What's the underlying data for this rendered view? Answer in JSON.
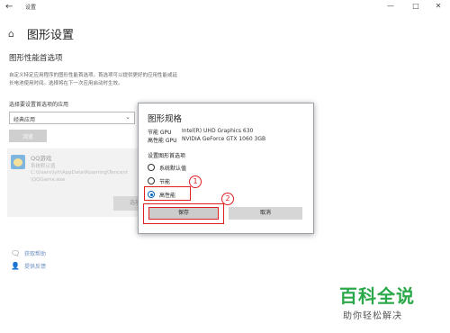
{
  "window": {
    "title": "设置",
    "back_icon": "←",
    "minimize_icon": "—",
    "maximize_icon": "□",
    "close_icon": "✕"
  },
  "page": {
    "home_icon": "⌂",
    "title": "图形设置",
    "section_heading": "图形性能首选项",
    "description": "自定义特定应用程序的图形性能首选项。首选项可以提供更好的应用性能或延长电池使用时间。选择将在下一次应用启动时生效。",
    "select_label": "选择要设置首选项的应用",
    "select_value": "经典应用",
    "select_chevron": "⌄",
    "browse_label": "浏览"
  },
  "app_card": {
    "name": "QQ游戏",
    "setting": "系统默认值",
    "path_line1": "C:\\Users\\lyh\\AppData\\Roaming\\Tencent",
    "path_line2": "\\QQGame.exe",
    "options_label": "选项"
  },
  "links": {
    "help_icon": "🗨",
    "help": "获取帮助",
    "feedback_icon": "👤",
    "feedback": "提供反馈"
  },
  "dialog": {
    "title": "图形规格",
    "gpu_power_saving_label": "节能 GPU",
    "gpu_power_saving_value": "Intel(R) UHD Graphics 630",
    "gpu_high_perf_label": "高性能 GPU",
    "gpu_high_perf_value": "NVIDIA GeForce GTX 1060 3GB",
    "preference_heading": "设置图形首选项",
    "options": [
      "系统默认值",
      "节能",
      "高性能"
    ],
    "selected_option": "高性能",
    "save_label": "保存",
    "cancel_label": "取消"
  },
  "annotations": {
    "step1": "1",
    "step2": "2"
  },
  "watermark": {
    "main": "百科全说",
    "sub": "助你轻松解决"
  },
  "colors": {
    "accent": "#0067c0",
    "annotation_red": "#e02020",
    "watermark_green": "#2aa84a",
    "link_blue": "#6d8fc0"
  }
}
